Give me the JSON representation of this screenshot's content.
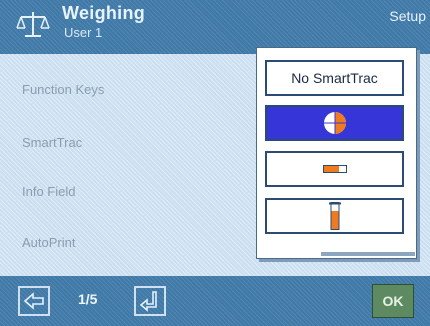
{
  "header": {
    "title": "Weighing",
    "user": "User 1",
    "section": "Setup",
    "icon": "balance-scale-icon"
  },
  "menu": {
    "items": [
      "Function Keys",
      "SmartTrac",
      "Info Field",
      "AutoPrint"
    ]
  },
  "popup": {
    "options": [
      {
        "label": "No SmartTrac",
        "icon": null,
        "selected": false
      },
      {
        "label": "",
        "icon": "circle-smarttrac-icon",
        "selected": true
      },
      {
        "label": "",
        "icon": "horizontal-bar-smarttrac-icon",
        "selected": false
      },
      {
        "label": "",
        "icon": "vertical-bar-smarttrac-icon",
        "selected": false
      }
    ]
  },
  "footer": {
    "page_indicator": "1/5",
    "ok_label": "OK",
    "prev_icon": "arrow-left-icon",
    "next_icon": "arrow-down-left-icon"
  },
  "colors": {
    "header_bg": "#3f79a7",
    "body_bg": "#c9def0",
    "selected_option_bg": "#3535d8",
    "smarttrac_orange": "#f07a1e",
    "ok_button_bg": "#5e8a62"
  }
}
